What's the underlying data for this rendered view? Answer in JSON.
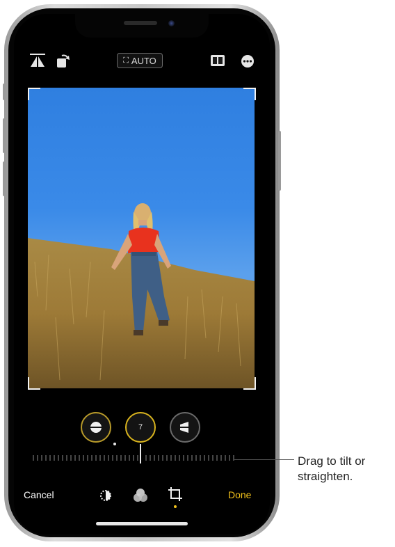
{
  "topbar": {
    "auto_label": "AUTO"
  },
  "adjust_dial": {
    "value": "7"
  },
  "bottombar": {
    "cancel_label": "Cancel",
    "done_label": "Done"
  },
  "callout": {
    "line1": "Drag to tilt or",
    "line2": "straighten."
  },
  "colors": {
    "accent": "#f2c21b",
    "sky": "#3a8ae8",
    "grass": "#b08a3a",
    "shirt": "#e8321e",
    "jeans": "#3f5f86"
  },
  "icons": [
    "flip-horizontal-icon",
    "rotate-icon",
    "crop-auto-icon",
    "aspect-ratio-icon",
    "more-icon",
    "straighten-icon",
    "vertical-perspective-icon",
    "horizontal-perspective-icon",
    "adjust-dial-icon",
    "filters-icon",
    "crop-icon"
  ]
}
